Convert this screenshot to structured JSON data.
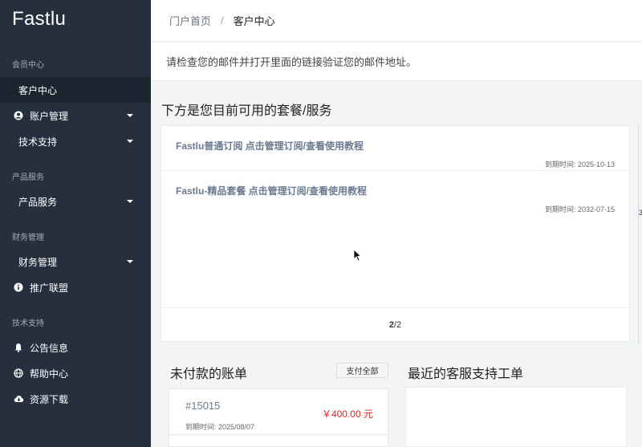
{
  "sidebar": {
    "brand": "Fastlu",
    "sections": [
      "会员中心",
      "产品服务",
      "财务管理",
      "技术支持"
    ],
    "items": [
      {
        "label": "客户中心"
      },
      {
        "label": "账户管理",
        "icon": "user-circle-icon"
      },
      {
        "label": "技术支持"
      },
      {
        "label": "产品服务"
      },
      {
        "label": "财务管理"
      },
      {
        "label": "推广联盟",
        "icon": "info-circle-icon"
      },
      {
        "label": "公告信息",
        "icon": "bell-icon"
      },
      {
        "label": "帮助中心",
        "icon": "globe-icon"
      },
      {
        "label": "资源下载",
        "icon": "cloud-download-icon"
      }
    ]
  },
  "breadcrumb": {
    "home": "门户首页",
    "separator": "/",
    "current": "客户中心"
  },
  "notice": "请检查您的邮件并打开里面的链接验证您的邮件地址。",
  "services": {
    "title": "下方是您目前可用的套餐/服务",
    "items": [
      {
        "name": "Fastlu普通订阅 点击管理订阅/查看使用教程",
        "expiry": "到期时间: 2025-10-13"
      },
      {
        "name": "Fastlu-精品套餐 点击管理订阅/查看使用教程",
        "expiry": "到期时间: 2032-07-15"
      }
    ],
    "pager": {
      "current": "2",
      "total": "/2"
    }
  },
  "right_partial": "3",
  "bills": {
    "title": "未付款的账单",
    "pay_all": "支付全部",
    "items": [
      {
        "number": "#15015",
        "due": "到期时间: 2025/08/07",
        "amount": "￥400.00 元"
      }
    ]
  },
  "tickets": {
    "title": "最近的客服支持工单"
  },
  "colors": {
    "sidebar_bg": "#252f3e",
    "active_bg": "#1c2430",
    "accent_red": "#e02424",
    "service_name": "#6b7a90"
  }
}
